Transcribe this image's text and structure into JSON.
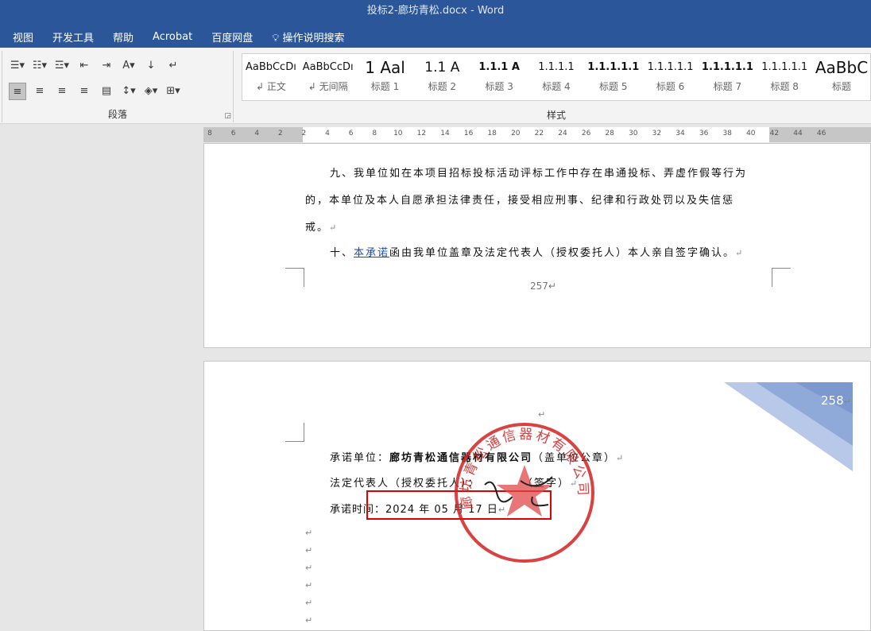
{
  "window": {
    "title": "投标2-廊坊青松.docx  -  Word"
  },
  "menu": [
    "视图",
    "开发工具",
    "帮助",
    "Acrobat",
    "百度网盘",
    "操作说明搜索"
  ],
  "ribbon": {
    "paragraph_label": "段落",
    "styles_label": "样式",
    "styles": [
      {
        "preview": "AaBbCcDı",
        "name": "↲ 正文"
      },
      {
        "preview": "AaBbCcDı",
        "name": "↲ 无间隔"
      },
      {
        "preview": "1  Aal",
        "name": "标题 1"
      },
      {
        "preview": "1.1  A",
        "name": "标题 2"
      },
      {
        "preview": "1.1.1 A",
        "name": "标题 3"
      },
      {
        "preview": "1.1.1.1",
        "name": "标题 4"
      },
      {
        "preview": "1.1.1.1.1",
        "name": "标题 5"
      },
      {
        "preview": "1.1.1.1.1",
        "name": "标题 6"
      },
      {
        "preview": "1.1.1.1.1",
        "name": "标题 7"
      },
      {
        "preview": "1.1.1.1.1",
        "name": "标题 8"
      },
      {
        "preview": "AaBbC",
        "name": "标题"
      }
    ]
  },
  "ruler": {
    "ticks": [
      "8",
      "6",
      "4",
      "2",
      "2",
      "4",
      "6",
      "8",
      "10",
      "12",
      "14",
      "16",
      "18",
      "20",
      "22",
      "24",
      "26",
      "28",
      "30",
      "32",
      "34",
      "36",
      "38",
      "40",
      "42",
      "44",
      "46"
    ]
  },
  "page1": {
    "lines": [
      "九、我单位如在本项目招标投标活动评标工作中存在串通投标、弄虚作假等行为",
      "的，本单位及本人自愿承担法律责任，接受相应刑事、纪律和行政处罚以及失信惩",
      "戒。"
    ],
    "line4_prefix": "十、",
    "line4_link": "本承诺",
    "line4_rest": "函由我单位盖章及法定代表人（授权委托人）本人亲自签字确认。",
    "page_number": "257"
  },
  "page2": {
    "page_number": "258",
    "unit_label": "承诺单位：",
    "unit_name": "廊坊青松通信器材有限公司",
    "unit_suffix": "（盖单位公章）",
    "rep_label": "法定代表人（授权委托人）：",
    "rep_suffix": "（签字）",
    "date_text": "承诺时间：2024 年 05 月 17 日",
    "stamp_text": "廊坊青松通信器材有限公司"
  },
  "colors": {
    "accent": "#2b579a",
    "highlight_box": "#e00000",
    "stamp": "#d42020"
  }
}
